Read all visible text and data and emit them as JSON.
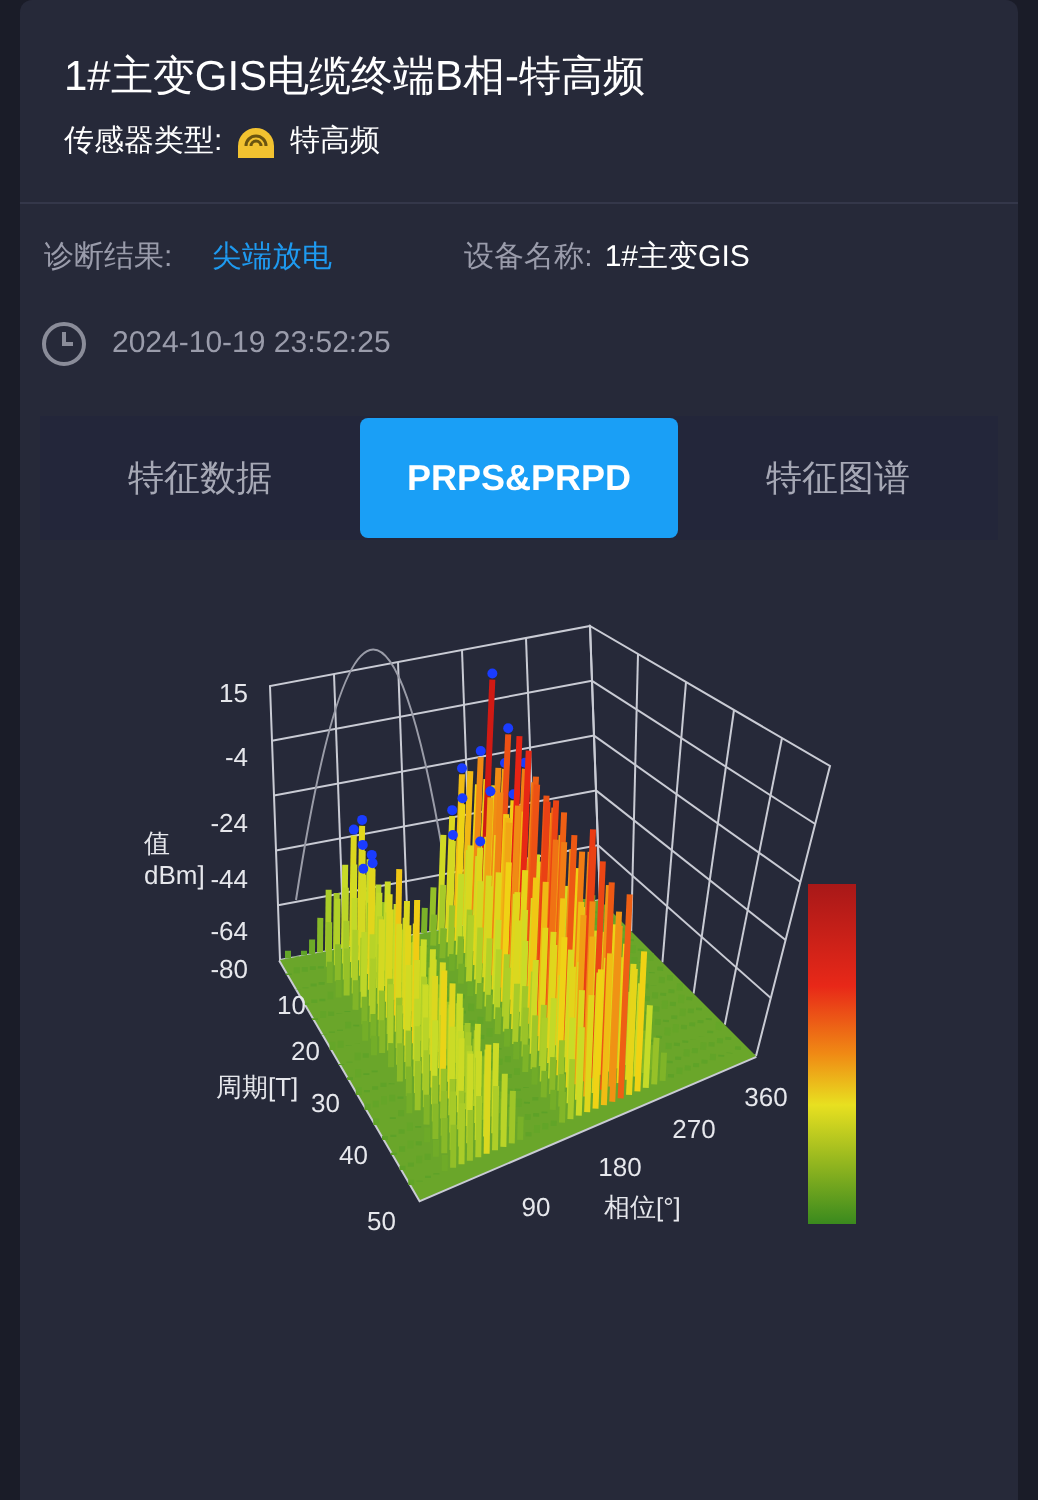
{
  "header": {
    "title": "1#主变GIS电缆终端B相-特高频",
    "sensor_label": "传感器类型:",
    "sensor_type": "特高频"
  },
  "info": {
    "diagnosis_label": "诊断结果:",
    "diagnosis_value": "尖端放电",
    "device_label": "设备名称:",
    "device_value": "1#主变GIS",
    "timestamp": "2024-10-19 23:52:25"
  },
  "tabs": [
    {
      "label": "特征数据",
      "selected": false
    },
    {
      "label": "PRPS&PRPD",
      "selected": true
    },
    {
      "label": "特征图谱",
      "selected": false
    }
  ],
  "chart": {
    "amplitude_ticks": [
      "15",
      "-4",
      "-24",
      "-44",
      "-64",
      "-80"
    ],
    "amplitude_title": [
      "值",
      "dBm]"
    ],
    "period_ticks": [
      "10",
      "20",
      "30",
      "40",
      "50"
    ],
    "period_title": "周期[T]",
    "phase_ticks": [
      "90",
      "180",
      "270",
      "360"
    ],
    "phase_title": "相位[°]"
  }
}
